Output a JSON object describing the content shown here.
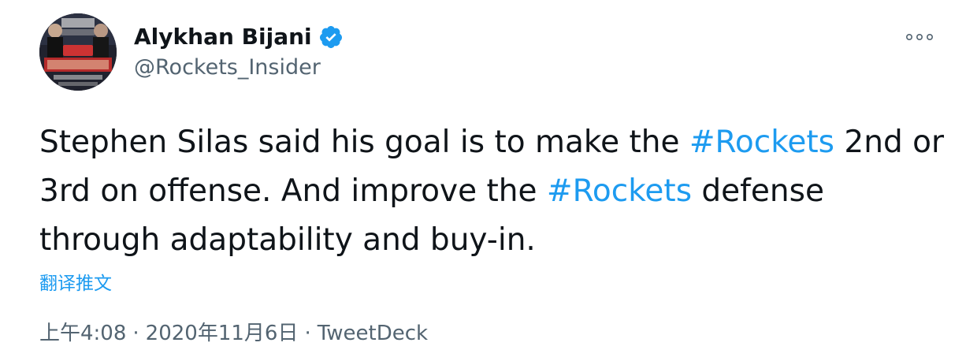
{
  "author": {
    "display_name": "Alykhan Bijani",
    "handle": "@Rockets_Insider",
    "verified": true,
    "avatar_icon": "profile-photo"
  },
  "more_icon": "more-horizontal-icon",
  "tweet": {
    "segments": [
      {
        "text": "Stephen Silas said his goal is to make the ",
        "type": "text"
      },
      {
        "text": "#Rockets",
        "type": "hashtag"
      },
      {
        "text": " 2nd or 3rd on offense. And improve the ",
        "type": "text"
      },
      {
        "text": "#Rockets",
        "type": "hashtag"
      },
      {
        "text": " defense through adaptability and buy-in.",
        "type": "text"
      }
    ]
  },
  "translate_label": "翻译推文",
  "meta": {
    "time": "上午4:08",
    "separator": "·",
    "date": "2020年11月6日",
    "source": "TweetDeck"
  },
  "colors": {
    "link": "#1d9bf0",
    "secondary_text": "#536471",
    "primary_text": "#0f1419"
  }
}
